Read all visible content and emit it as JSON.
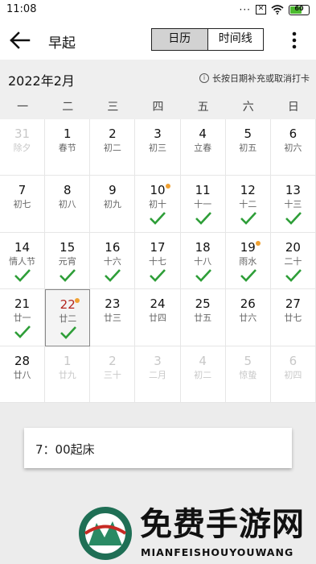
{
  "status_bar": {
    "time": "11:08",
    "battery": "60"
  },
  "app_bar": {
    "title": "早起",
    "tabs": [
      "日历",
      "时间线"
    ]
  },
  "month_bar": {
    "month": "2022年2月",
    "hint": "长按日期补充或取消打卡"
  },
  "weekdays": [
    "一",
    "二",
    "三",
    "四",
    "五",
    "六",
    "日"
  ],
  "calendar": {
    "days": [
      {
        "d": "31",
        "l": "除夕",
        "dim": true
      },
      {
        "d": "1",
        "l": "春节"
      },
      {
        "d": "2",
        "l": "初二"
      },
      {
        "d": "3",
        "l": "初三"
      },
      {
        "d": "4",
        "l": "立春"
      },
      {
        "d": "5",
        "l": "初五"
      },
      {
        "d": "6",
        "l": "初六"
      },
      {
        "d": "7",
        "l": "初七"
      },
      {
        "d": "8",
        "l": "初八"
      },
      {
        "d": "9",
        "l": "初九"
      },
      {
        "d": "10",
        "l": "初十",
        "dot": true,
        "check": true
      },
      {
        "d": "11",
        "l": "十一",
        "check": true
      },
      {
        "d": "12",
        "l": "十二",
        "check": true
      },
      {
        "d": "13",
        "l": "十三",
        "check": true
      },
      {
        "d": "14",
        "l": "情人节",
        "check": true
      },
      {
        "d": "15",
        "l": "元宵",
        "check": true
      },
      {
        "d": "16",
        "l": "十六",
        "check": true
      },
      {
        "d": "17",
        "l": "十七",
        "check": true
      },
      {
        "d": "18",
        "l": "十八",
        "check": true
      },
      {
        "d": "19",
        "l": "雨水",
        "dot": true,
        "check": true
      },
      {
        "d": "20",
        "l": "二十",
        "check": true
      },
      {
        "d": "21",
        "l": "廿一",
        "check": true
      },
      {
        "d": "22",
        "l": "廿二",
        "dot": true,
        "check": true,
        "today": true
      },
      {
        "d": "23",
        "l": "廿三"
      },
      {
        "d": "24",
        "l": "廿四"
      },
      {
        "d": "25",
        "l": "廿五"
      },
      {
        "d": "26",
        "l": "廿六"
      },
      {
        "d": "27",
        "l": "廿七"
      },
      {
        "d": "28",
        "l": "廿八"
      },
      {
        "d": "1",
        "l": "廿九",
        "dim": true
      },
      {
        "d": "2",
        "l": "三十",
        "dim": true
      },
      {
        "d": "3",
        "l": "二月",
        "dim": true
      },
      {
        "d": "4",
        "l": "初二",
        "dim": true
      },
      {
        "d": "5",
        "l": "惊蛰",
        "dim": true
      },
      {
        "d": "6",
        "l": "初四",
        "dim": true
      }
    ]
  },
  "note": {
    "text": "7：00起床"
  },
  "watermark": {
    "title": "免费手游网",
    "subtitle": "MIANFEISHOUYOUWANG"
  },
  "colors": {
    "check": "#2e9e38",
    "dot": "#f0a132",
    "today_number": "#b3251f",
    "battery": "#4cbb2f"
  },
  "icons": {
    "back": "arrow-left-icon",
    "menu": "more-vertical-icon",
    "info": "info-circle-icon",
    "check": "checkmark-icon"
  }
}
